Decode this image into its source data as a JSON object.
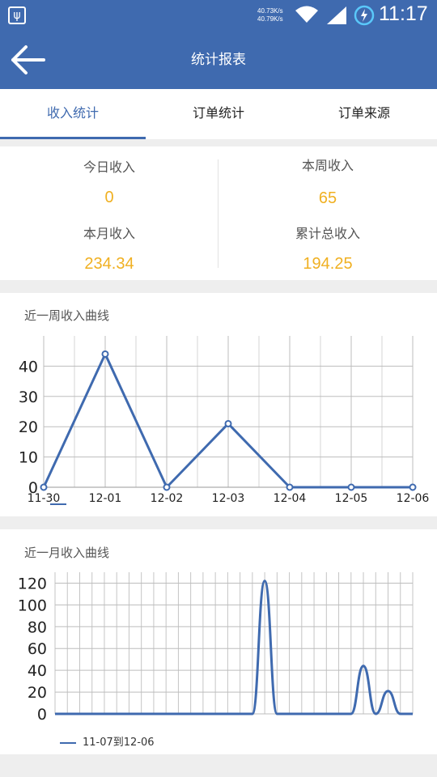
{
  "status_bar": {
    "net_up": "40.73K/s",
    "net_down": "40.79K/s",
    "time": "11:17"
  },
  "app_bar": {
    "title": "统计报表"
  },
  "tabs": [
    {
      "label": "收入统计",
      "active": true
    },
    {
      "label": "订单统计",
      "active": false
    },
    {
      "label": "订单来源",
      "active": false
    }
  ],
  "stats": {
    "today_label": "今日收入",
    "today_value": "0",
    "week_label": "本周收入",
    "week_value": "65",
    "month_label": "本月收入",
    "month_value": "234.34",
    "total_label": "累计总收入",
    "total_value": "194.25"
  },
  "colors": {
    "accent": "#3f6aaf",
    "value": "#f0b021"
  },
  "chart_data": [
    {
      "type": "line",
      "title": "近一周收入曲线",
      "x": [
        "11-30",
        "12-01",
        "12-02",
        "12-03",
        "12-04",
        "12-05",
        "12-06"
      ],
      "values": [
        0,
        44,
        0,
        21,
        0,
        0,
        0
      ],
      "yticks": [
        0,
        10,
        20,
        30,
        40
      ],
      "ylim": [
        0,
        50
      ],
      "grid": true
    },
    {
      "type": "line",
      "title": "近一月收入曲线",
      "series": [
        {
          "name": "11-07到12-06",
          "values": [
            0,
            0,
            0,
            0,
            0,
            0,
            0,
            0,
            0,
            0,
            0,
            0,
            0,
            0,
            0,
            0,
            0,
            122,
            0,
            0,
            0,
            0,
            0,
            0,
            0,
            44,
            0,
            21,
            0,
            0
          ]
        }
      ],
      "yticks": [
        0,
        20,
        40,
        60,
        80,
        100,
        120
      ],
      "ylim": [
        0,
        130
      ],
      "grid": true,
      "legend": "bottom-left"
    }
  ]
}
